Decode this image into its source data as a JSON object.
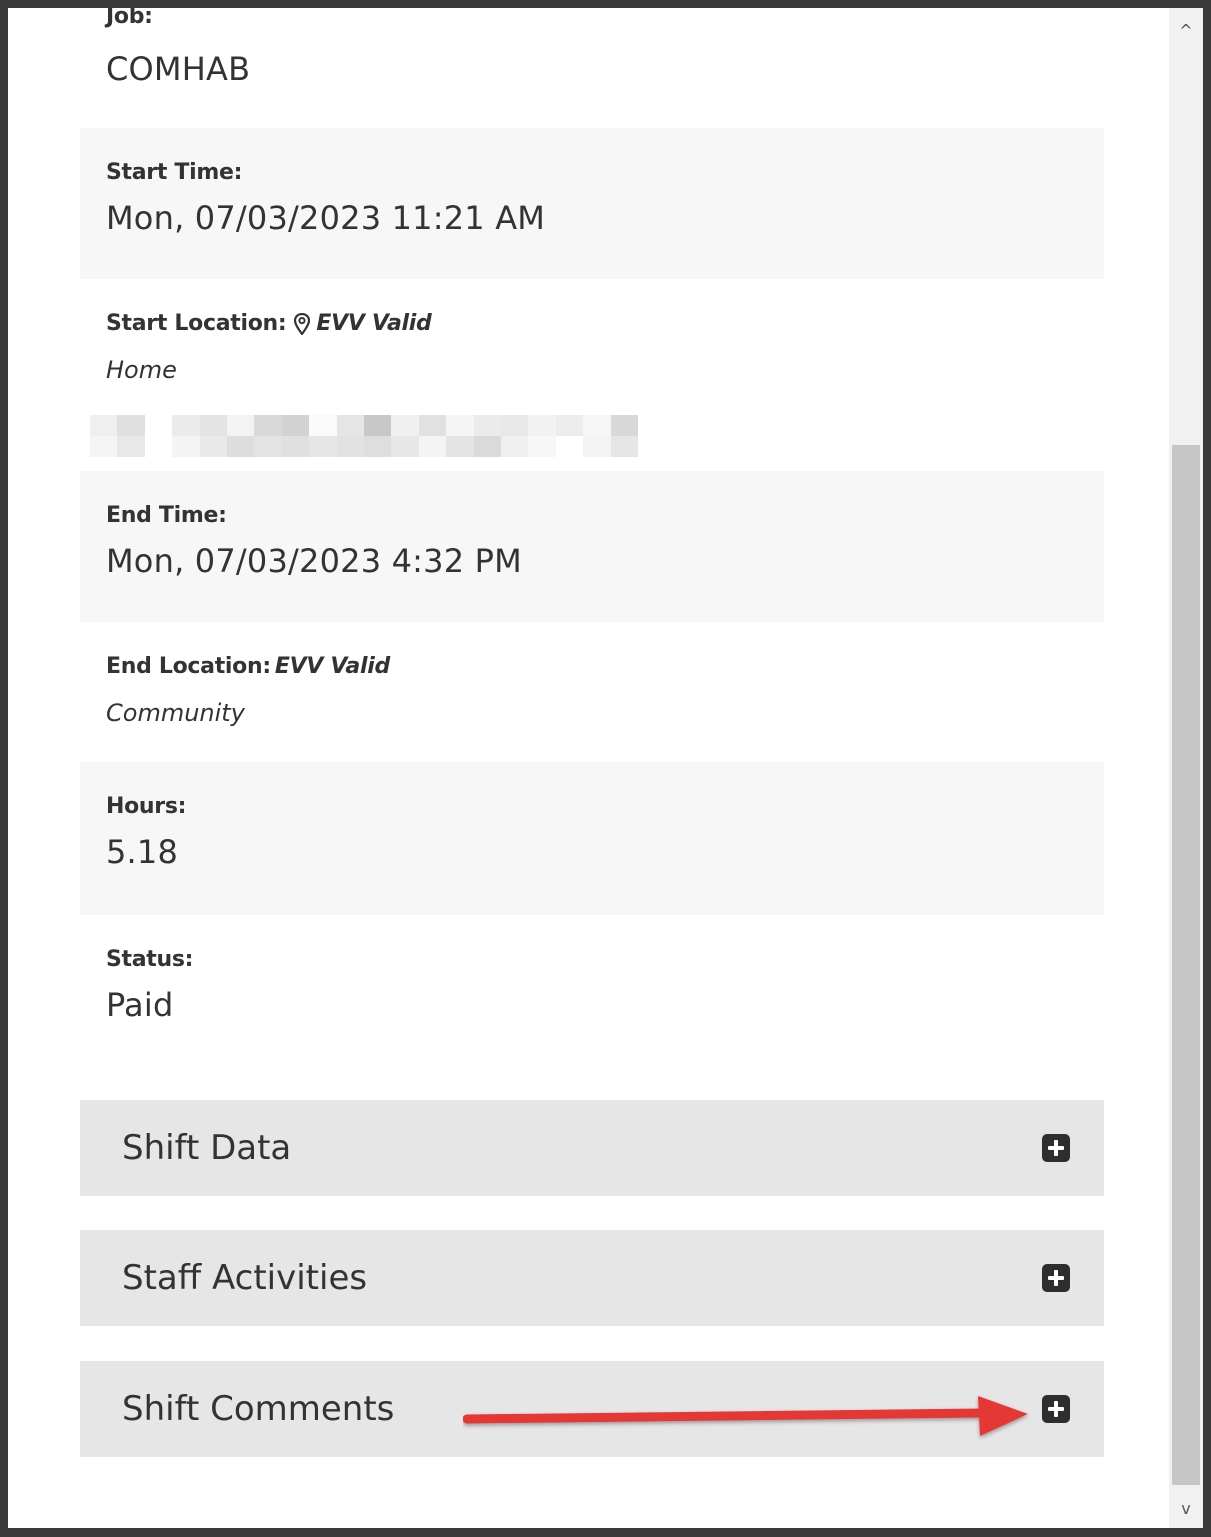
{
  "job": {
    "label": "Job:",
    "value": "COMHAB"
  },
  "start_time": {
    "label": "Start Time:",
    "value": "Mon, 07/03/2023 11:21 AM"
  },
  "start_location": {
    "label": "Start Location:",
    "evv": "EVV Valid",
    "place": "Home",
    "pin_icon": "map-pin-icon"
  },
  "end_time": {
    "label": "End Time:",
    "value": "Mon, 07/03/2023 4:32 PM"
  },
  "end_location": {
    "label": "End Location:",
    "evv": "EVV Valid",
    "place": "Community"
  },
  "hours": {
    "label": "Hours:",
    "value": "5.18"
  },
  "status": {
    "label": "Status:",
    "value": "Paid"
  },
  "sections": [
    {
      "title": "Shift Data",
      "icon": "plus-square-icon"
    },
    {
      "title": "Staff Activities",
      "icon": "plus-square-icon"
    },
    {
      "title": "Shift Comments",
      "icon": "plus-square-icon"
    }
  ],
  "annotation": {
    "arrow_color": "#e53935"
  },
  "scrollbar": {
    "up": "^",
    "down": "v"
  }
}
